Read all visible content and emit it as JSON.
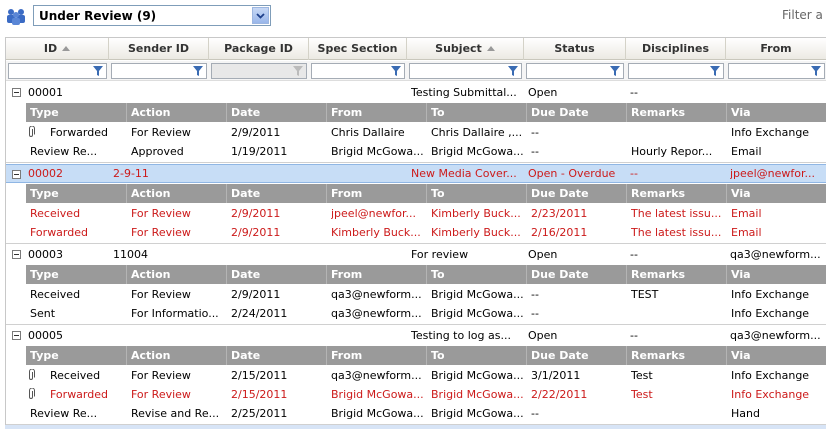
{
  "toolbar": {
    "view_selected": "Under Review (9)",
    "filter_label": "Filter a",
    "people_icon": "people-group-icon",
    "dropdown_icon": "chevron-down-icon"
  },
  "colors": {
    "overdue_text": "#cc1a1a",
    "selected_row": "#c7ddf6",
    "subheader": "#9a9a9a"
  },
  "columns": [
    {
      "key": "id",
      "label": "ID",
      "sorted": true
    },
    {
      "key": "sender",
      "label": "Sender ID"
    },
    {
      "key": "package",
      "label": "Package ID"
    },
    {
      "key": "spec",
      "label": "Spec Section"
    },
    {
      "key": "subject",
      "label": "Subject",
      "sorted": true
    },
    {
      "key": "status",
      "label": "Status"
    },
    {
      "key": "disciplines",
      "label": "Disciplines"
    },
    {
      "key": "from",
      "label": "From"
    }
  ],
  "sub_columns": [
    "Type",
    "Action",
    "Date",
    "From",
    "To",
    "Due Date",
    "Remarks",
    "Via"
  ],
  "groups": [
    {
      "id": "00001",
      "sender": "",
      "subject": "Testing Submittal...",
      "status": "Open",
      "disciplines": "--",
      "from": "",
      "red": false,
      "selected": false,
      "rows": [
        {
          "attach": true,
          "type": "Forwarded",
          "action": "For Review",
          "date": "2/9/2011",
          "from": "Chris Dallaire",
          "to": "Chris Dallaire ,...",
          "due": "--",
          "remarks": "",
          "via": "Info Exchange",
          "red": false
        },
        {
          "attach": false,
          "type": "Review Re...",
          "action": "Approved",
          "date": "1/19/2011",
          "from": "Brigid McGowa...",
          "to": "Brigid McGowa...",
          "due": "--",
          "remarks": "Hourly Repor...",
          "via": "Email",
          "red": false
        }
      ]
    },
    {
      "id": "00002",
      "sender": "2-9-11",
      "subject": "New Media Cover...",
      "status": "Open - Overdue",
      "disciplines": "--",
      "from": "jpeel@newfor...",
      "red": true,
      "selected": true,
      "rows": [
        {
          "attach": false,
          "type": "Received",
          "action": "For Review",
          "date": "2/9/2011",
          "from": "jpeel@newfor...",
          "to": "Kimberly Buck...",
          "due": "2/23/2011",
          "remarks": "The latest issu...",
          "via": "Email",
          "red": true
        },
        {
          "attach": false,
          "type": "Forwarded",
          "action": "For Review",
          "date": "2/9/2011",
          "from": "Kimberly Buck...",
          "to": "Kimberly Buck...",
          "due": "2/16/2011",
          "remarks": "The latest issu...",
          "via": "Email",
          "red": true
        }
      ]
    },
    {
      "id": "00003",
      "sender": "11004",
      "subject": "For review",
      "status": "Open",
      "disciplines": "--",
      "from": "qa3@newform...",
      "red": false,
      "selected": false,
      "rows": [
        {
          "attach": false,
          "type": "Received",
          "action": "For Review",
          "date": "2/9/2011",
          "from": "qa3@newform...",
          "to": "Brigid McGowa...",
          "due": "--",
          "remarks": "TEST",
          "via": "Info Exchange",
          "red": false
        },
        {
          "attach": false,
          "type": "Sent",
          "action": "For Informatio...",
          "date": "2/24/2011",
          "from": "qa3@newform...",
          "to": "Brigid McGowa...",
          "due": "--",
          "remarks": "",
          "via": "Info Exchange",
          "red": false
        }
      ]
    },
    {
      "id": "00005",
      "sender": "",
      "subject": "Testing to log as...",
      "status": "Open",
      "disciplines": "--",
      "from": "qa3@newform...",
      "red": false,
      "selected": false,
      "rows": [
        {
          "attach": true,
          "type": "Received",
          "action": "For Review",
          "date": "2/15/2011",
          "from": "qa3@newform...",
          "to": "Brigid McGowa...",
          "due": "3/1/2011",
          "remarks": "Test",
          "via": "Info Exchange",
          "red": false
        },
        {
          "attach": true,
          "type": "Forwarded",
          "action": "For Review",
          "date": "2/15/2011",
          "from": "Brigid McGowa...",
          "to": "Brigid McGowa...",
          "due": "2/22/2011",
          "remarks": "Test",
          "via": "Info Exchange",
          "red": true
        },
        {
          "attach": false,
          "type": "Review Re...",
          "action": "Revise and Re...",
          "date": "2/25/2011",
          "from": "Brigid McGowa...",
          "to": "Brigid McGowa...",
          "due": "--",
          "remarks": "",
          "via": "Hand",
          "red": false
        }
      ]
    }
  ]
}
